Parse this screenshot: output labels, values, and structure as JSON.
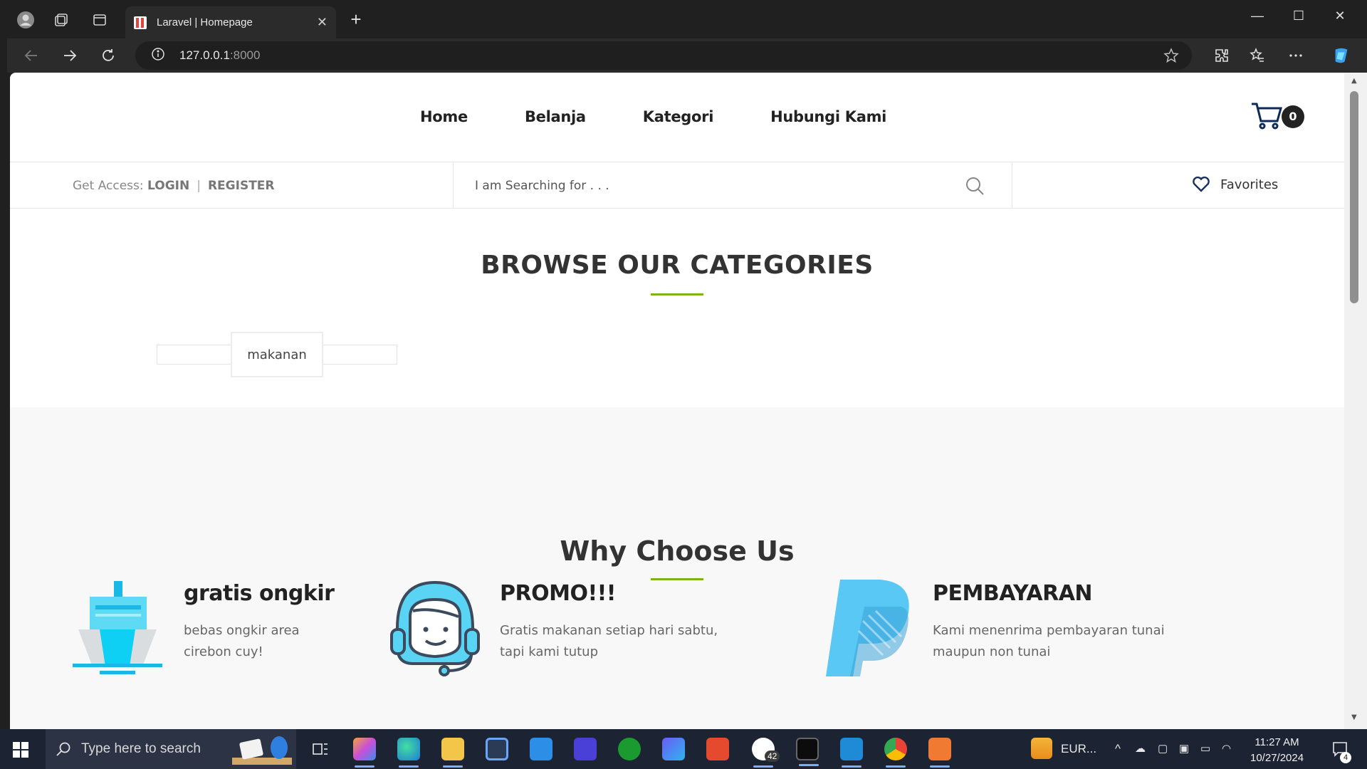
{
  "browser": {
    "tab_title": "Laravel | Homepage",
    "url_host": "127.0.0.1",
    "url_port": ":8000"
  },
  "header": {
    "menu": [
      {
        "label": "Home"
      },
      {
        "label": "Belanja"
      },
      {
        "label": "Kategori"
      },
      {
        "label": "Hubungi Kami"
      }
    ],
    "cart_count": "0"
  },
  "subbar": {
    "access_label": "Get Access:",
    "login_label": "LOGIN",
    "separator": "|",
    "register_label": "REGISTER",
    "search_placeholder": "I am Searching for . . .",
    "favorites_label": "Favorites"
  },
  "categories": {
    "title": "BROWSE OUR CATEGORIES",
    "items": [
      {
        "label": "makanan"
      }
    ]
  },
  "why": {
    "title": "Why Choose Us",
    "features": [
      {
        "title": "gratis ongkir",
        "line1": "bebas ongkir area",
        "line2": "cirebon cuy!",
        "icon": "ship-icon"
      },
      {
        "title": "PROMO!!!",
        "line1": "Gratis makanan setiap hari sabtu,",
        "line2": "tapi kami tutup",
        "icon": "support-agent-icon"
      },
      {
        "title": "PEMBAYARAN",
        "line1": "Kami menenrima pembayaran tunai",
        "line2": "maupun non tunai",
        "icon": "paypal-icon"
      }
    ]
  },
  "taskbar": {
    "search_placeholder": "Type here to search",
    "whatsapp_badge": "42",
    "weather_text": "EUR...",
    "time": "11:27 AM",
    "date": "10/27/2024",
    "notification_count": "4"
  },
  "colors": {
    "accent_green": "#7cb518",
    "icon_cyan": "#5ad4f5",
    "paypal_blue": "#5bc4f2",
    "taskbar_bg": "#1c2433"
  }
}
